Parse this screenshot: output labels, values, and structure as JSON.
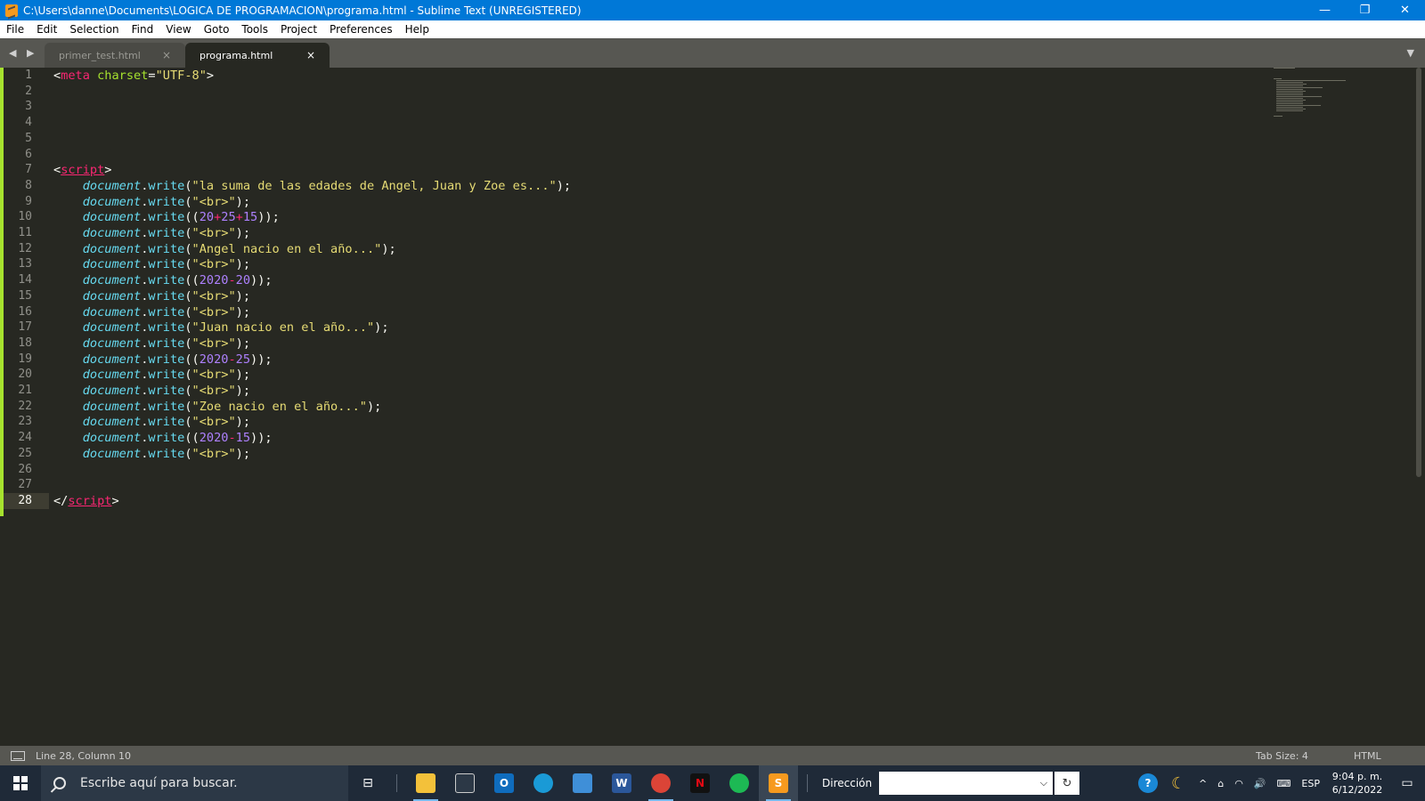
{
  "window": {
    "title": "C:\\Users\\danne\\Documents\\LOGICA DE PROGRAMACION\\programa.html - Sublime Text (UNREGISTERED)",
    "minimize": "—",
    "restore": "❐",
    "close": "✕"
  },
  "menu": [
    "File",
    "Edit",
    "Selection",
    "Find",
    "View",
    "Goto",
    "Tools",
    "Project",
    "Preferences",
    "Help"
  ],
  "tabs": [
    {
      "label": "primer_test.html",
      "close": "×",
      "active": false
    },
    {
      "label": "programa.html",
      "close": "×",
      "active": true
    }
  ],
  "tab_nav": "◀ ▶",
  "tab_dropdown": "▼",
  "editor": {
    "current_line": 28,
    "lines": [
      [
        [
          "k-pl",
          "<"
        ],
        [
          "k-tag",
          "meta"
        ],
        [
          "k-pl",
          " "
        ],
        [
          "k-attr",
          "charset"
        ],
        [
          "k-pl",
          "="
        ],
        [
          "k-str",
          "\"UTF-8\""
        ],
        [
          "k-pl",
          ">"
        ]
      ],
      [],
      [],
      [],
      [],
      [],
      [
        [
          "k-pl",
          "<"
        ],
        [
          "k-tag u",
          "script"
        ],
        [
          "k-pl",
          ">"
        ]
      ],
      [
        [
          "k-pl",
          "    "
        ],
        [
          "k-obj",
          "document"
        ],
        [
          "k-pl",
          "."
        ],
        [
          "k-fn",
          "write"
        ],
        [
          "k-pl",
          "("
        ],
        [
          "k-str",
          "\"la suma de las edades de Angel, Juan y Zoe es...\""
        ],
        [
          "k-pl",
          ");"
        ]
      ],
      [
        [
          "k-pl",
          "    "
        ],
        [
          "k-obj",
          "document"
        ],
        [
          "k-pl",
          "."
        ],
        [
          "k-fn",
          "write"
        ],
        [
          "k-pl",
          "("
        ],
        [
          "k-str",
          "\"<br>\""
        ],
        [
          "k-pl",
          ");"
        ]
      ],
      [
        [
          "k-pl",
          "    "
        ],
        [
          "k-obj",
          "document"
        ],
        [
          "k-pl",
          "."
        ],
        [
          "k-fn",
          "write"
        ],
        [
          "k-pl",
          "(("
        ],
        [
          "k-num",
          "20"
        ],
        [
          "k-op",
          "+"
        ],
        [
          "k-num",
          "25"
        ],
        [
          "k-op",
          "+"
        ],
        [
          "k-num",
          "15"
        ],
        [
          "k-pl",
          "));"
        ]
      ],
      [
        [
          "k-pl",
          "    "
        ],
        [
          "k-obj",
          "document"
        ],
        [
          "k-pl",
          "."
        ],
        [
          "k-fn",
          "write"
        ],
        [
          "k-pl",
          "("
        ],
        [
          "k-str",
          "\"<br>\""
        ],
        [
          "k-pl",
          ");"
        ]
      ],
      [
        [
          "k-pl",
          "    "
        ],
        [
          "k-obj",
          "document"
        ],
        [
          "k-pl",
          "."
        ],
        [
          "k-fn",
          "write"
        ],
        [
          "k-pl",
          "("
        ],
        [
          "k-str",
          "\"Angel nacio en el año...\""
        ],
        [
          "k-pl",
          ");"
        ]
      ],
      [
        [
          "k-pl",
          "    "
        ],
        [
          "k-obj",
          "document"
        ],
        [
          "k-pl",
          "."
        ],
        [
          "k-fn",
          "write"
        ],
        [
          "k-pl",
          "("
        ],
        [
          "k-str",
          "\"<br>\""
        ],
        [
          "k-pl",
          ");"
        ]
      ],
      [
        [
          "k-pl",
          "    "
        ],
        [
          "k-obj",
          "document"
        ],
        [
          "k-pl",
          "."
        ],
        [
          "k-fn",
          "write"
        ],
        [
          "k-pl",
          "(("
        ],
        [
          "k-num",
          "2020"
        ],
        [
          "k-op",
          "-"
        ],
        [
          "k-num",
          "20"
        ],
        [
          "k-pl",
          "));"
        ]
      ],
      [
        [
          "k-pl",
          "    "
        ],
        [
          "k-obj",
          "document"
        ],
        [
          "k-pl",
          "."
        ],
        [
          "k-fn",
          "write"
        ],
        [
          "k-pl",
          "("
        ],
        [
          "k-str",
          "\"<br>\""
        ],
        [
          "k-pl",
          ");"
        ]
      ],
      [
        [
          "k-pl",
          "    "
        ],
        [
          "k-obj",
          "document"
        ],
        [
          "k-pl",
          "."
        ],
        [
          "k-fn",
          "write"
        ],
        [
          "k-pl",
          "("
        ],
        [
          "k-str",
          "\"<br>\""
        ],
        [
          "k-pl",
          ");"
        ]
      ],
      [
        [
          "k-pl",
          "    "
        ],
        [
          "k-obj",
          "document"
        ],
        [
          "k-pl",
          "."
        ],
        [
          "k-fn",
          "write"
        ],
        [
          "k-pl",
          "("
        ],
        [
          "k-str",
          "\"Juan nacio en el año...\""
        ],
        [
          "k-pl",
          ");"
        ]
      ],
      [
        [
          "k-pl",
          "    "
        ],
        [
          "k-obj",
          "document"
        ],
        [
          "k-pl",
          "."
        ],
        [
          "k-fn",
          "write"
        ],
        [
          "k-pl",
          "("
        ],
        [
          "k-str",
          "\"<br>\""
        ],
        [
          "k-pl",
          ");"
        ]
      ],
      [
        [
          "k-pl",
          "    "
        ],
        [
          "k-obj",
          "document"
        ],
        [
          "k-pl",
          "."
        ],
        [
          "k-fn",
          "write"
        ],
        [
          "k-pl",
          "(("
        ],
        [
          "k-num",
          "2020"
        ],
        [
          "k-op",
          "-"
        ],
        [
          "k-num",
          "25"
        ],
        [
          "k-pl",
          "));"
        ]
      ],
      [
        [
          "k-pl",
          "    "
        ],
        [
          "k-obj",
          "document"
        ],
        [
          "k-pl",
          "."
        ],
        [
          "k-fn",
          "write"
        ],
        [
          "k-pl",
          "("
        ],
        [
          "k-str",
          "\"<br>\""
        ],
        [
          "k-pl",
          ");"
        ]
      ],
      [
        [
          "k-pl",
          "    "
        ],
        [
          "k-obj",
          "document"
        ],
        [
          "k-pl",
          "."
        ],
        [
          "k-fn",
          "write"
        ],
        [
          "k-pl",
          "("
        ],
        [
          "k-str",
          "\"<br>\""
        ],
        [
          "k-pl",
          ");"
        ]
      ],
      [
        [
          "k-pl",
          "    "
        ],
        [
          "k-obj",
          "document"
        ],
        [
          "k-pl",
          "."
        ],
        [
          "k-fn",
          "write"
        ],
        [
          "k-pl",
          "("
        ],
        [
          "k-str",
          "\"Zoe nacio en el año...\""
        ],
        [
          "k-pl",
          ");"
        ]
      ],
      [
        [
          "k-pl",
          "    "
        ],
        [
          "k-obj",
          "document"
        ],
        [
          "k-pl",
          "."
        ],
        [
          "k-fn",
          "write"
        ],
        [
          "k-pl",
          "("
        ],
        [
          "k-str",
          "\"<br>\""
        ],
        [
          "k-pl",
          ");"
        ]
      ],
      [
        [
          "k-pl",
          "    "
        ],
        [
          "k-obj",
          "document"
        ],
        [
          "k-pl",
          "."
        ],
        [
          "k-fn",
          "write"
        ],
        [
          "k-pl",
          "(("
        ],
        [
          "k-num",
          "2020"
        ],
        [
          "k-op",
          "-"
        ],
        [
          "k-num",
          "15"
        ],
        [
          "k-pl",
          "));"
        ]
      ],
      [
        [
          "k-pl",
          "    "
        ],
        [
          "k-obj",
          "document"
        ],
        [
          "k-pl",
          "."
        ],
        [
          "k-fn",
          "write"
        ],
        [
          "k-pl",
          "("
        ],
        [
          "k-str",
          "\"<br>\""
        ],
        [
          "k-pl",
          ");"
        ]
      ],
      [],
      [],
      [
        [
          "k-pl",
          "</"
        ],
        [
          "k-tag u",
          "script"
        ],
        [
          "k-pl",
          ">"
        ]
      ]
    ]
  },
  "status": {
    "position": "Line 28, Column 10",
    "tab_size": "Tab Size: 4",
    "syntax": "HTML"
  },
  "taskbar": {
    "search_placeholder": "Escribe aquí para buscar.",
    "address_label": "Dirección",
    "address_dropdown": "⌵",
    "address_refresh": "↻",
    "language": "ESP",
    "time": "9:04 p. m.",
    "date": "6/12/2022",
    "tray_icons": [
      "^",
      "⌂",
      "◠",
      "🔊",
      "⌨"
    ],
    "notification": "▭"
  },
  "colors": {
    "titlebar": "#0078d7",
    "editor_bg": "#272822",
    "tag": "#f92672",
    "string": "#e6db74",
    "number": "#ae81ff",
    "keyword_obj": "#66d9ef",
    "attr": "#a6e22e"
  }
}
